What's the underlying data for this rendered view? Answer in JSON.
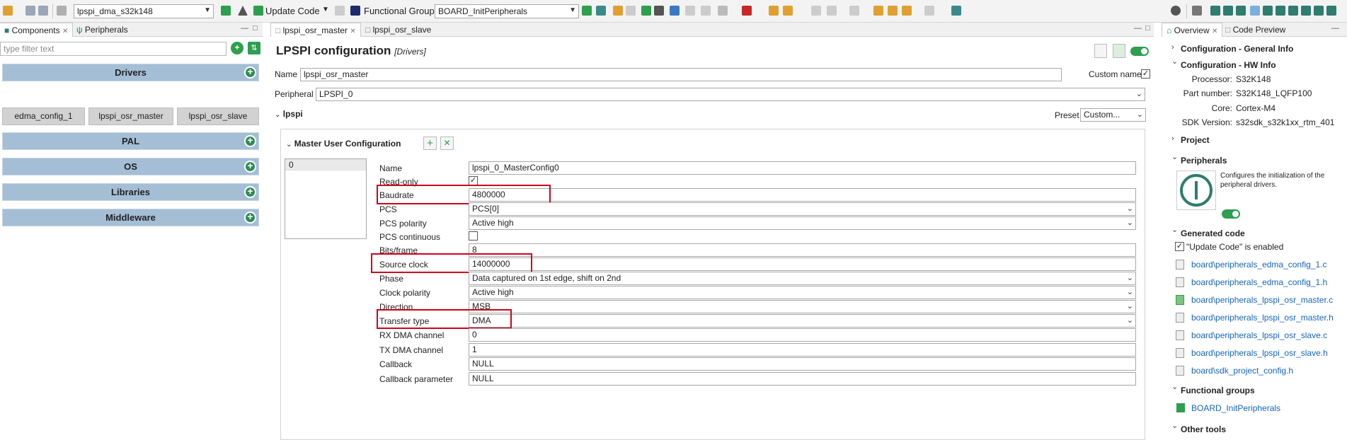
{
  "toolbar": {
    "project_combo": "lpspi_dma_s32k148",
    "update_code_label": "Update Code",
    "functional_group_label": "Functional Group",
    "functional_group_combo": "BOARD_InitPeripherals"
  },
  "left_panel": {
    "tabs": [
      "Components",
      "Peripherals"
    ],
    "filter_placeholder": "type filter text",
    "groups": {
      "drivers": "Drivers",
      "pal": "PAL",
      "os": "OS",
      "libraries": "Libraries",
      "middleware": "Middleware"
    },
    "components": [
      "edma_config_1",
      "lpspi_osr_master",
      "lpspi_osr_slave"
    ]
  },
  "editor": {
    "tabs": [
      "lpspi_osr_master",
      "lpspi_osr_slave"
    ],
    "title": "LPSPI configuration",
    "title_suffix": "[Drivers]",
    "name_label": "Name",
    "name_value": "lpspi_osr_master",
    "custom_name_label": "Custom name",
    "peripheral_label": "Peripheral",
    "peripheral_value": "LPSPI_0",
    "section_label": "lpspi",
    "preset_label": "Preset",
    "preset_value": "Custom...",
    "master_section": "Master User Configuration",
    "list_index": "0",
    "fields": {
      "name": {
        "label": "Name",
        "value": "lpspi_0_MasterConfig0"
      },
      "read_only": {
        "label": "Read-only"
      },
      "baudrate": {
        "label": "Baudrate",
        "value": "4800000"
      },
      "pcs": {
        "label": "PCS",
        "value": "PCS[0]"
      },
      "pcs_polarity": {
        "label": "PCS polarity",
        "value": "Active high"
      },
      "pcs_continuous": {
        "label": "PCS continuous"
      },
      "bits_frame": {
        "label": "Bits/frame",
        "value": "8"
      },
      "source_clock": {
        "label": "Source clock",
        "value": "14000000"
      },
      "phase": {
        "label": "Phase",
        "value": "Data captured on 1st edge, shift on 2nd"
      },
      "clock_polarity": {
        "label": "Clock polarity",
        "value": "Active high"
      },
      "direction": {
        "label": "Direction",
        "value": "MSB"
      },
      "transfer_type": {
        "label": "Transfer type",
        "value": "DMA"
      },
      "rx_dma": {
        "label": "RX DMA channel",
        "value": "0"
      },
      "tx_dma": {
        "label": "TX DMA channel",
        "value": "1"
      },
      "callback": {
        "label": "Callback",
        "value": "NULL"
      },
      "callback_param": {
        "label": "Callback parameter",
        "value": "NULL"
      }
    }
  },
  "right_panel": {
    "tabs": [
      "Overview",
      "Code Preview"
    ],
    "general_info": "Configuration - General Info",
    "hw_info": "Configuration - HW Info",
    "hw": {
      "processor_label": "Processor:",
      "processor_value": "S32K148",
      "part_label": "Part number:",
      "part_value": "S32K148_LQFP100",
      "core_label": "Core:",
      "core_value": "Cortex-M4",
      "sdk_label": "SDK Version:",
      "sdk_value": "s32sdk_s32k1xx_rtm_401"
    },
    "project": "Project",
    "peripherals": "Peripherals",
    "peripherals_desc": "Configures the initialization of the peripheral drivers.",
    "generated_code": "Generated code",
    "update_code_enabled": "\"Update Code\" is enabled",
    "files": [
      "board\\peripherals_edma_config_1.c",
      "board\\peripherals_edma_config_1.h",
      "board\\peripherals_lpspi_osr_master.c",
      "board\\peripherals_lpspi_osr_master.h",
      "board\\peripherals_lpspi_osr_slave.c",
      "board\\peripherals_lpspi_osr_slave.h",
      "board\\sdk_project_config.h"
    ],
    "functional_groups": "Functional groups",
    "fg_item": "BOARD_InitPeripherals",
    "other_tools": "Other tools"
  },
  "colors": {
    "accent_green": "#2e9e4f",
    "highlight_red": "#d0021b",
    "group_blue": "#a4bed6",
    "link_blue": "#1565c0"
  }
}
